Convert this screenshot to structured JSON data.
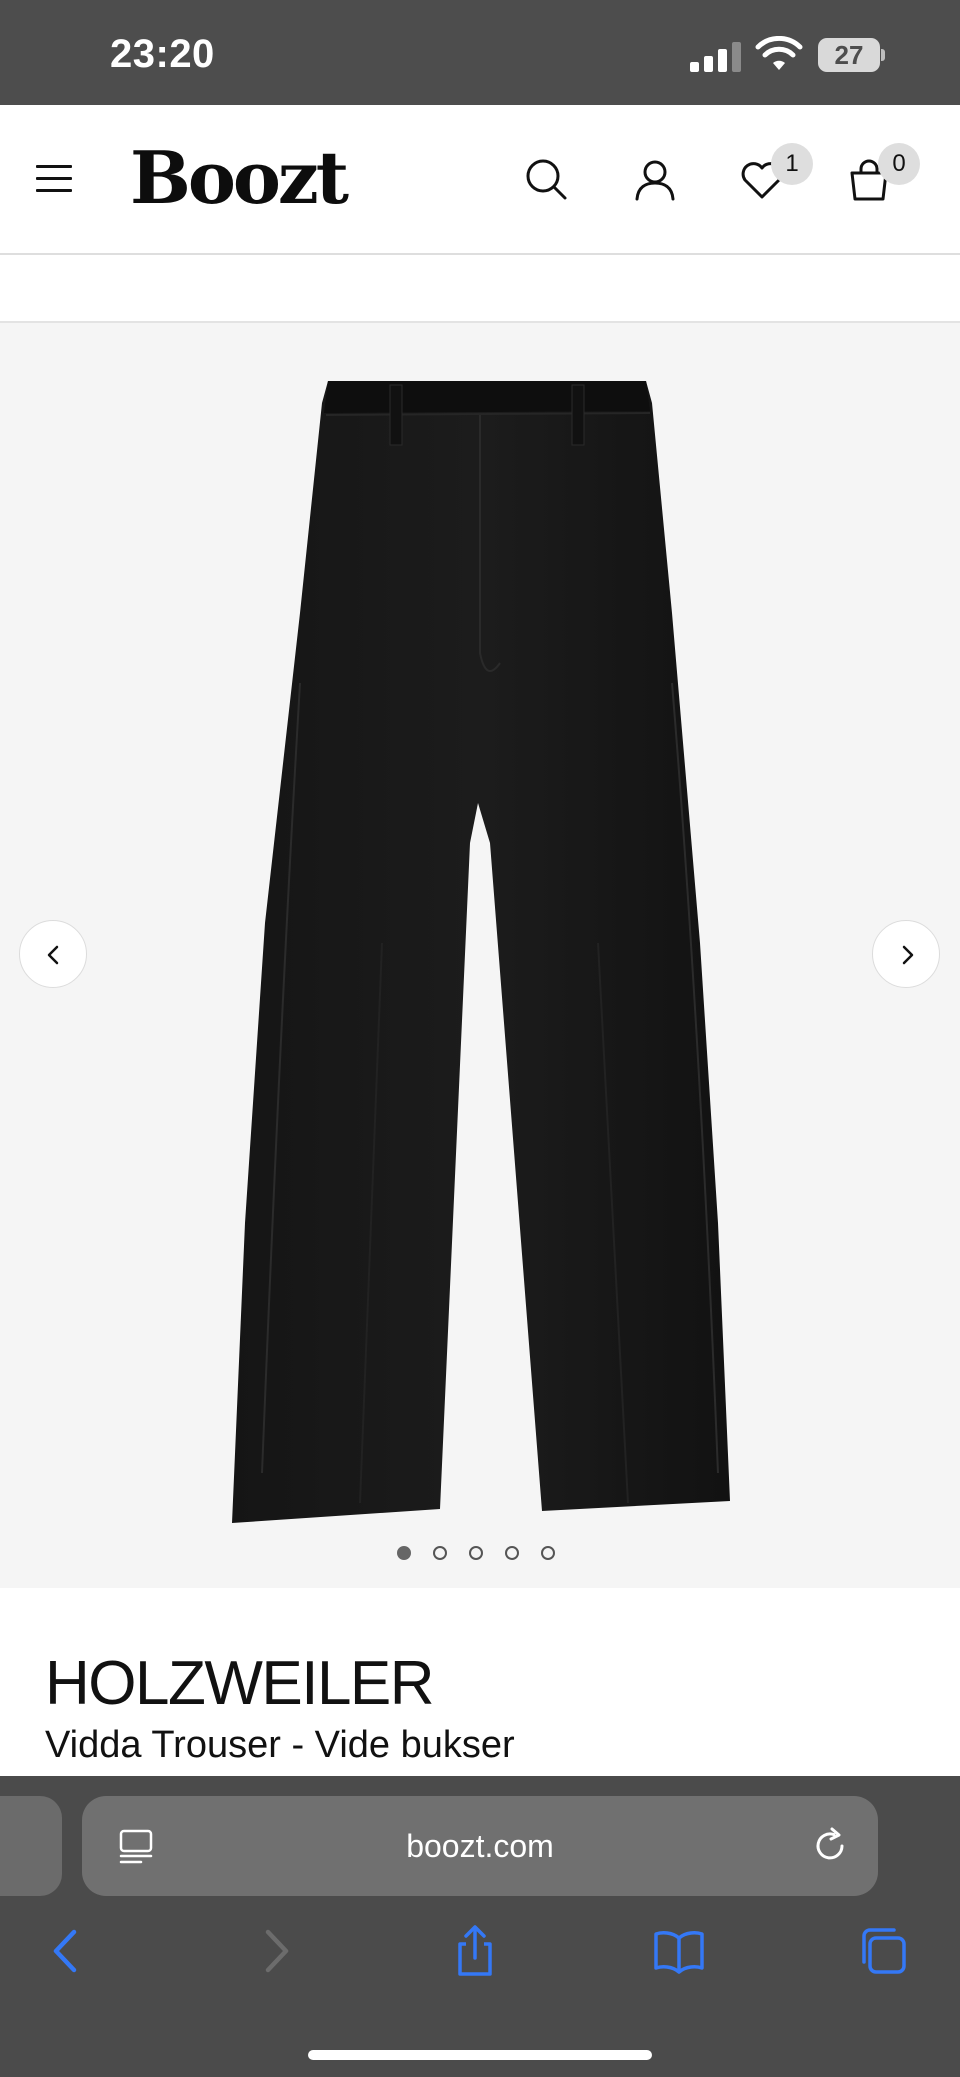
{
  "status_bar": {
    "time": "23:20",
    "battery": "27"
  },
  "header": {
    "logo": "Boozt",
    "wishlist_count": "1",
    "cart_count": "0"
  },
  "gallery": {
    "image_count": 5,
    "active_index": 0
  },
  "product": {
    "brand": "HOLZWEILER",
    "name": "Vidda Trouser - Vide bukser"
  },
  "browser": {
    "url": "boozt.com"
  },
  "icons": {
    "menu": "hamburger-menu-icon",
    "search": "search-icon",
    "account": "user-icon",
    "wishlist": "heart-icon",
    "cart": "shopping-bag-icon",
    "prev": "chevron-left-icon",
    "next": "chevron-right-icon"
  },
  "colors": {
    "accent": "#3478f6",
    "status_bar": "#4d4d4d",
    "browser_chrome": "#4b4b4b"
  }
}
